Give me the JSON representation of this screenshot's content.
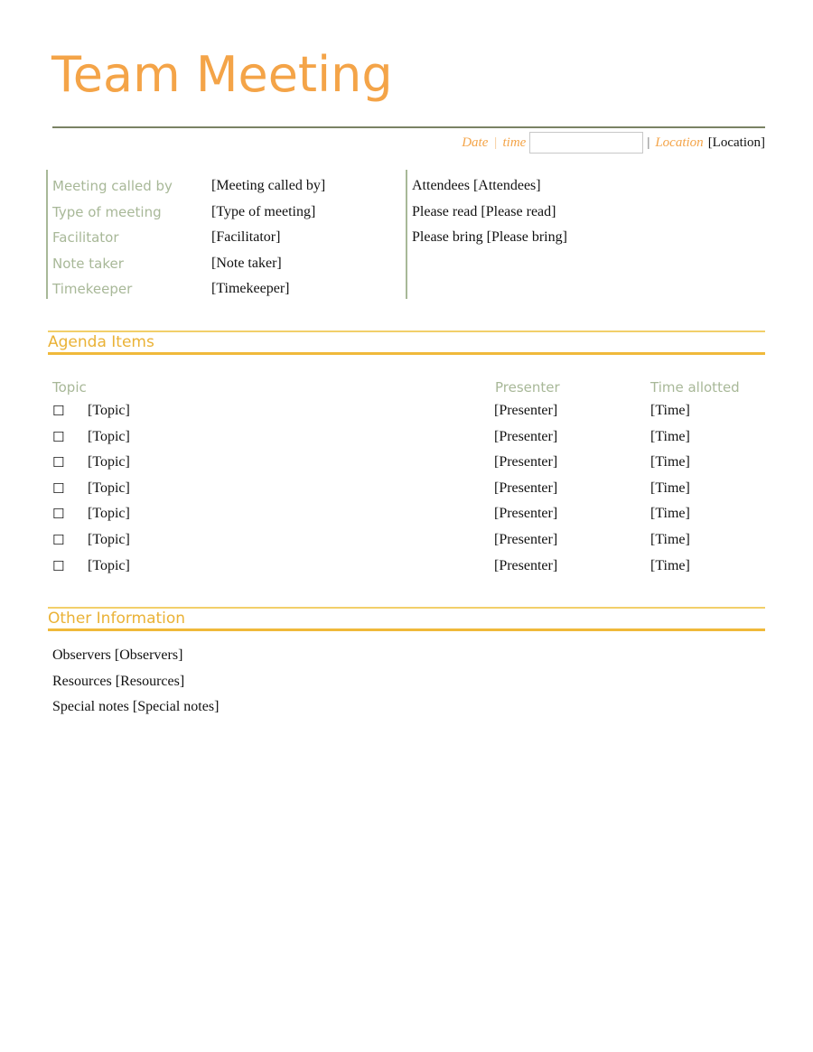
{
  "title": "Team Meeting",
  "header": {
    "date_label": "Date",
    "separator": "|",
    "time_label": "time",
    "date_time_value": "",
    "location_label": "Location",
    "location_value": "[Location]"
  },
  "details": {
    "left": [
      {
        "label": "Meeting called by",
        "value": "[Meeting called by]"
      },
      {
        "label": "Type of meeting",
        "value": "[Type of meeting]"
      },
      {
        "label": "Facilitator",
        "value": "[Facilitator]"
      },
      {
        "label": "Note taker",
        "value": "[Note taker]"
      },
      {
        "label": "Timekeeper",
        "value": "[Timekeeper]"
      }
    ],
    "right": [
      {
        "text": "Attendees [Attendees]"
      },
      {
        "text": "Please read [Please read]"
      },
      {
        "text": "Please bring [Please bring]"
      }
    ]
  },
  "agenda": {
    "heading": "Agenda Items",
    "columns": {
      "topic": "Topic",
      "presenter": "Presenter",
      "time": "Time allotted"
    },
    "checkbox_glyph": "☐",
    "rows": [
      {
        "topic": "[Topic]",
        "presenter": "[Presenter]",
        "time": "[Time]"
      },
      {
        "topic": "[Topic]",
        "presenter": "[Presenter]",
        "time": "[Time]"
      },
      {
        "topic": "[Topic]",
        "presenter": "[Presenter]",
        "time": "[Time]"
      },
      {
        "topic": "[Topic]",
        "presenter": "[Presenter]",
        "time": "[Time]"
      },
      {
        "topic": "[Topic]",
        "presenter": "[Presenter]",
        "time": "[Time]"
      },
      {
        "topic": "[Topic]",
        "presenter": "[Presenter]",
        "time": "[Time]"
      },
      {
        "topic": "[Topic]",
        "presenter": "[Presenter]",
        "time": "[Time]"
      }
    ]
  },
  "other": {
    "heading": "Other Information",
    "lines": [
      {
        "text": "Observers [Observers]"
      },
      {
        "text": "Resources [Resources]"
      },
      {
        "text": "Special notes [Special notes]"
      }
    ]
  },
  "colors": {
    "title": "#f4a448",
    "label": "#a8b898",
    "section": "#eab236",
    "rule": "#f0b93a"
  }
}
